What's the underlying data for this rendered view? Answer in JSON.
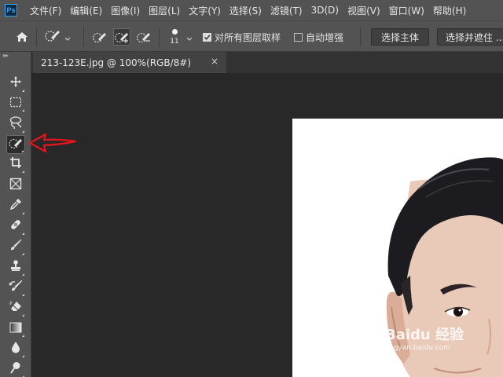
{
  "app": {
    "logo_text": "Ps"
  },
  "menu": [
    "文件(F)",
    "编辑(E)",
    "图像(I)",
    "图层(L)",
    "文字(Y)",
    "选择(S)",
    "滤镜(T)",
    "3D(D)",
    "视图(V)",
    "窗口(W)",
    "帮助(H)"
  ],
  "options": {
    "brush_size": "11",
    "sample_all_layers": {
      "label": "对所有图层取样",
      "checked": true
    },
    "auto_enhance": {
      "label": "自动增强",
      "checked": false
    },
    "select_subject_label": "选择主体",
    "select_and_mask_label": "选择并遮住 ..."
  },
  "document_tab": {
    "title": "213-123E.jpg @ 100%(RGB/8#)",
    "close_glyph": "×"
  },
  "toolbar": {
    "tools": [
      {
        "name": "move-tool",
        "icon": "move-icon"
      },
      {
        "name": "marquee-tool",
        "icon": "rect-marquee-icon"
      },
      {
        "name": "lasso-tool",
        "icon": "lasso-icon"
      },
      {
        "name": "quick-selection-tool",
        "icon": "quick-selection-icon",
        "selected": true
      },
      {
        "name": "crop-tool",
        "icon": "crop-icon"
      },
      {
        "name": "frame-tool",
        "icon": "frame-icon"
      },
      {
        "name": "eyedropper-tool",
        "icon": "eyedropper-icon"
      },
      {
        "name": "healing-brush-tool",
        "icon": "bandage-icon"
      },
      {
        "name": "brush-tool",
        "icon": "brush-icon"
      },
      {
        "name": "clone-stamp-tool",
        "icon": "stamp-icon"
      },
      {
        "name": "history-brush-tool",
        "icon": "history-brush-icon"
      },
      {
        "name": "eraser-tool",
        "icon": "eraser-icon"
      },
      {
        "name": "gradient-tool",
        "icon": "gradient-icon"
      },
      {
        "name": "blur-tool",
        "icon": "drop-icon"
      },
      {
        "name": "dodge-tool",
        "icon": "dodge-icon"
      }
    ]
  },
  "watermark": {
    "text": "Baidu 经验",
    "sub": "jingyan.baidu.com"
  },
  "colors": {
    "annotation_arrow": "#e8141c",
    "app_chrome": "#535353",
    "canvas_bg": "#282828"
  }
}
